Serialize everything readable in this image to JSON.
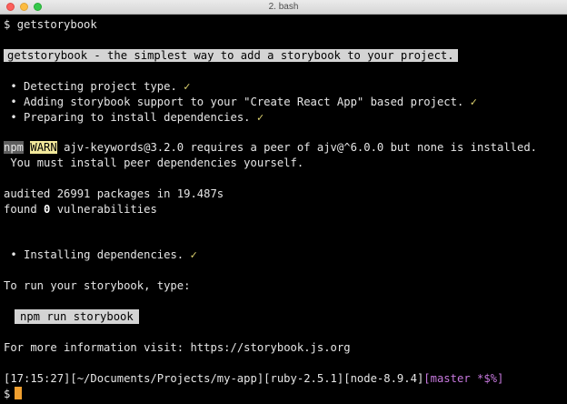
{
  "window": {
    "title": "2. bash"
  },
  "terminal": {
    "cmd_prompt": "$",
    "cmd_text": "getstorybook",
    "banner": "getstorybook - the simplest way to add a storybook to your project.",
    "steps": [
      {
        "bullet": "•",
        "text": "Detecting project type.",
        "check": "✓"
      },
      {
        "bullet": "•",
        "text": "Adding storybook support to your \"Create React App\" based project.",
        "check": "✓"
      },
      {
        "bullet": "•",
        "text": "Preparing to install dependencies.",
        "check": "✓"
      }
    ],
    "warn": {
      "npm": "npm",
      "tag": "WARN",
      "message": "ajv-keywords@3.2.0 requires a peer of ajv@^6.0.0 but none is installed.",
      "message2": "You must install peer dependencies yourself."
    },
    "audited": "audited 26991 packages in 19.487s",
    "found_pre": "found",
    "found_count": "0",
    "found_post": "vulnerabilities",
    "install_step": {
      "bullet": "•",
      "text": "Installing dependencies.",
      "check": "✓"
    },
    "run_hint": "To run your storybook, type:",
    "run_command": "npm run storybook",
    "more_info": "For more information visit:",
    "more_info_url": "https://storybook.js.org",
    "ps1": {
      "time": "[17:15:27]",
      "path": "[~/Documents/Projects/my-app]",
      "ruby": "[ruby-2.5.1]",
      "node": "[node-8.9.4]",
      "git": "[master *$%]"
    },
    "final_prompt": "$"
  },
  "colors": {
    "background": "#000000",
    "text": "#e6e6e6",
    "check": "#e6db74",
    "warn_bg": "#f2e89b",
    "git": "#c678dd",
    "cursor": "#f0a030"
  }
}
